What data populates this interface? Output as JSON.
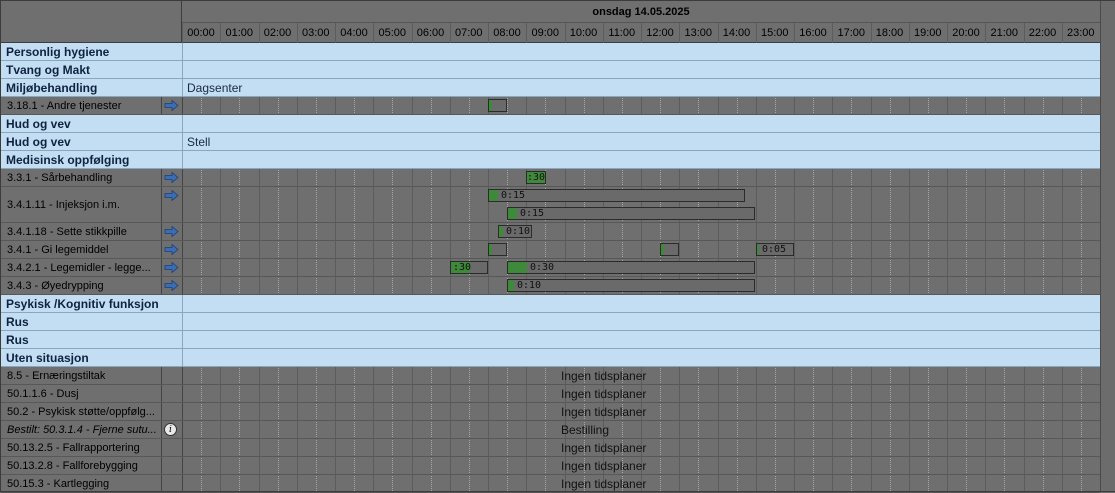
{
  "header": {
    "date": "onsdag 14.05.2025",
    "hours": [
      "00:00",
      "01:00",
      "02:00",
      "03:00",
      "04:00",
      "05:00",
      "06:00",
      "07:00",
      "08:00",
      "09:00",
      "10:00",
      "11:00",
      "12:00",
      "13:00",
      "14:00",
      "15:00",
      "16:00",
      "17:00",
      "18:00",
      "19:00",
      "20:00",
      "21:00",
      "22:00",
      "23:00"
    ]
  },
  "rows": {
    "r0": {
      "label": "Personlig hygiene"
    },
    "r1": {
      "label": "Tvang og Makt"
    },
    "r2": {
      "label": "Miljøbehandling",
      "sub": "Dagsenter"
    },
    "r3": {
      "label": "3.18.1 - Andre tjenester"
    },
    "r4": {
      "label": "Hud og vev"
    },
    "r5": {
      "label": "Hud og vev",
      "sub": "Stell"
    },
    "r6": {
      "label": "Medisinsk oppfølging"
    },
    "r7": {
      "label": "3.3.1 - Sårbehandling",
      "bars": [
        ":30"
      ]
    },
    "r8": {
      "label": "3.4.1.11 - Injeksjon i.m.",
      "bars": [
        "0:15",
        "0:15"
      ]
    },
    "r9": {
      "label": "3.4.1.18 - Sette stikkpille",
      "bars": [
        "0:10"
      ]
    },
    "r10": {
      "label": "3.4.1 - Gi legemiddel",
      "bars": [
        "",
        "",
        "0:05"
      ]
    },
    "r11": {
      "label": "3.4.2.1 - Legemidler - legge...",
      "bars": [
        ":30",
        "0:30"
      ]
    },
    "r12": {
      "label": "3.4.3 - Øyedrypping",
      "bars": [
        "0:10"
      ]
    },
    "r13": {
      "label": "Psykisk /Kognitiv funksjon"
    },
    "r14": {
      "label": "Rus"
    },
    "r15": {
      "label": "Rus"
    },
    "r16": {
      "label": "Uten situasjon"
    },
    "r17": {
      "label": "8.5 - Ernæringstiltak",
      "status": "Ingen tidsplaner"
    },
    "r18": {
      "label": "50.1.1.6 - Dusj",
      "status": "Ingen tidsplaner"
    },
    "r19": {
      "label": "50.2 - Psykisk støtte/oppfølg...",
      "status": "Ingen tidsplaner"
    },
    "r20": {
      "label": "Bestilt: 50.3.1.4 - Fjerne sutu...",
      "status": "Bestilling",
      "info_icon": "i"
    },
    "r21": {
      "label": "50.13.2.5 - Fallrapportering",
      "status": "Ingen tidsplaner"
    },
    "r22": {
      "label": "50.13.2.8 - Fallforebygging",
      "status": "Ingen tidsplaner"
    },
    "r23": {
      "label": "50.15.3 - Kartlegging",
      "status": "Ingen tidsplaner"
    }
  },
  "colors": {
    "group_bg": "#c3ddf2",
    "item_bg": "#6f6f6f",
    "bar_green": "#3f8a3a",
    "arrow_blue": "#3b6db3"
  }
}
